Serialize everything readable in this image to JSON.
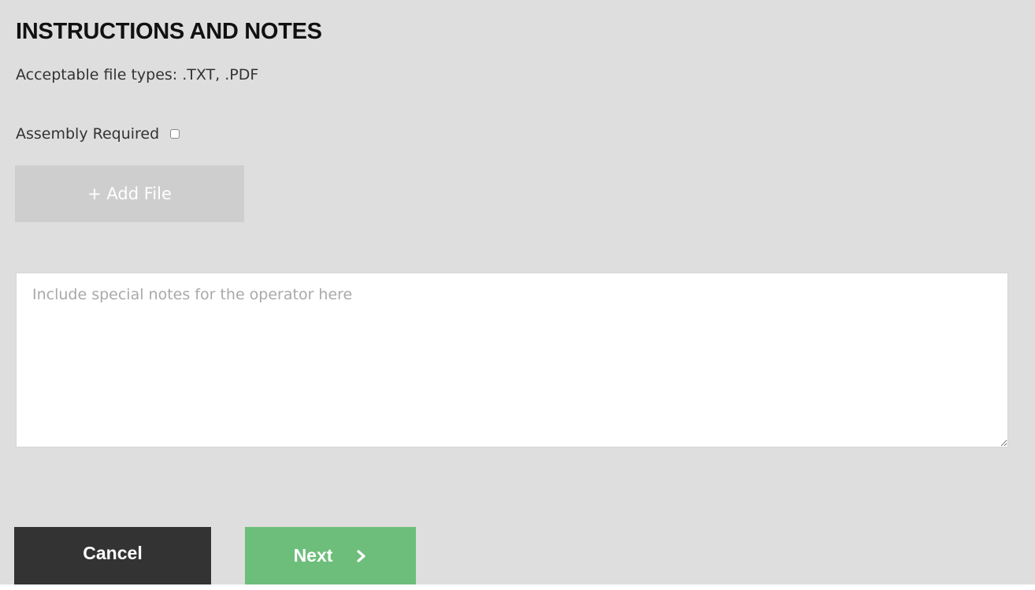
{
  "section": {
    "title": "INSTRUCTIONS AND NOTES",
    "file_types": "Acceptable file types: .TXT, .PDF"
  },
  "assembly": {
    "label": "Assembly Required",
    "checked": false
  },
  "add_file": {
    "label": "+ Add File",
    "state": "disabled"
  },
  "notes": {
    "value": "",
    "placeholder": "Include special notes for the operator here"
  },
  "actions": {
    "cancel_label": "Cancel",
    "next_label": "Next",
    "next_icon": "chevron-right-icon"
  },
  "colors": {
    "panel_background": "#dedede",
    "cancel_button": "#333333",
    "next_button": "#6dbe7b",
    "add_file_disabled": "#cecece"
  }
}
